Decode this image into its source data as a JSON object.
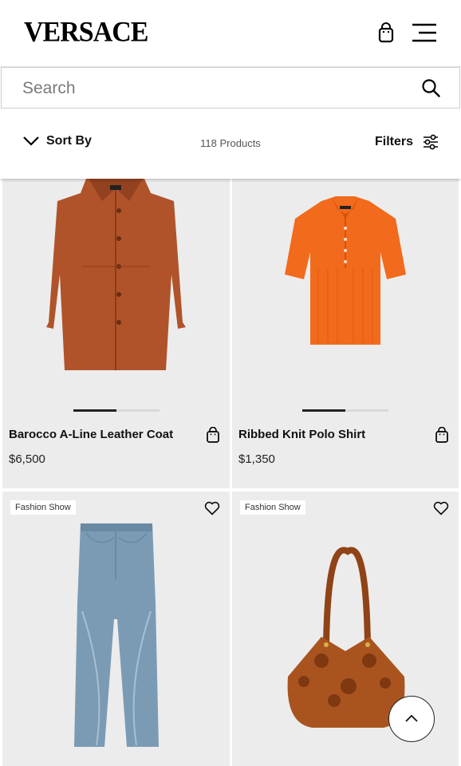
{
  "brand": {
    "logo_text": "VERSACE"
  },
  "header": {
    "bag_icon": "shopping-bag-icon",
    "menu_icon": "hamburger-menu-icon"
  },
  "search": {
    "placeholder": "Search",
    "icon": "search-icon"
  },
  "toolbar": {
    "sort_label": "Sort By",
    "product_count": "118 Products",
    "filters_label": "Filters"
  },
  "products": [
    {
      "name": "Barocco A-Line Leather Coat",
      "price": "$6,500",
      "badge": "",
      "image": "brown-leather-coat"
    },
    {
      "name": "Ribbed Knit Polo Shirt",
      "price": "$1,350",
      "badge": "",
      "image": "orange-knit-polo"
    },
    {
      "name": "",
      "price": "",
      "badge": "Fashion Show",
      "image": "denim-jeans"
    },
    {
      "name": "",
      "price": "",
      "badge": "Fashion Show",
      "image": "brown-suede-tote"
    }
  ],
  "colors": {
    "coat": "#b0532a",
    "polo": "#f26a1b",
    "denim": "#7b9bb5",
    "suede": "#a9541f"
  }
}
